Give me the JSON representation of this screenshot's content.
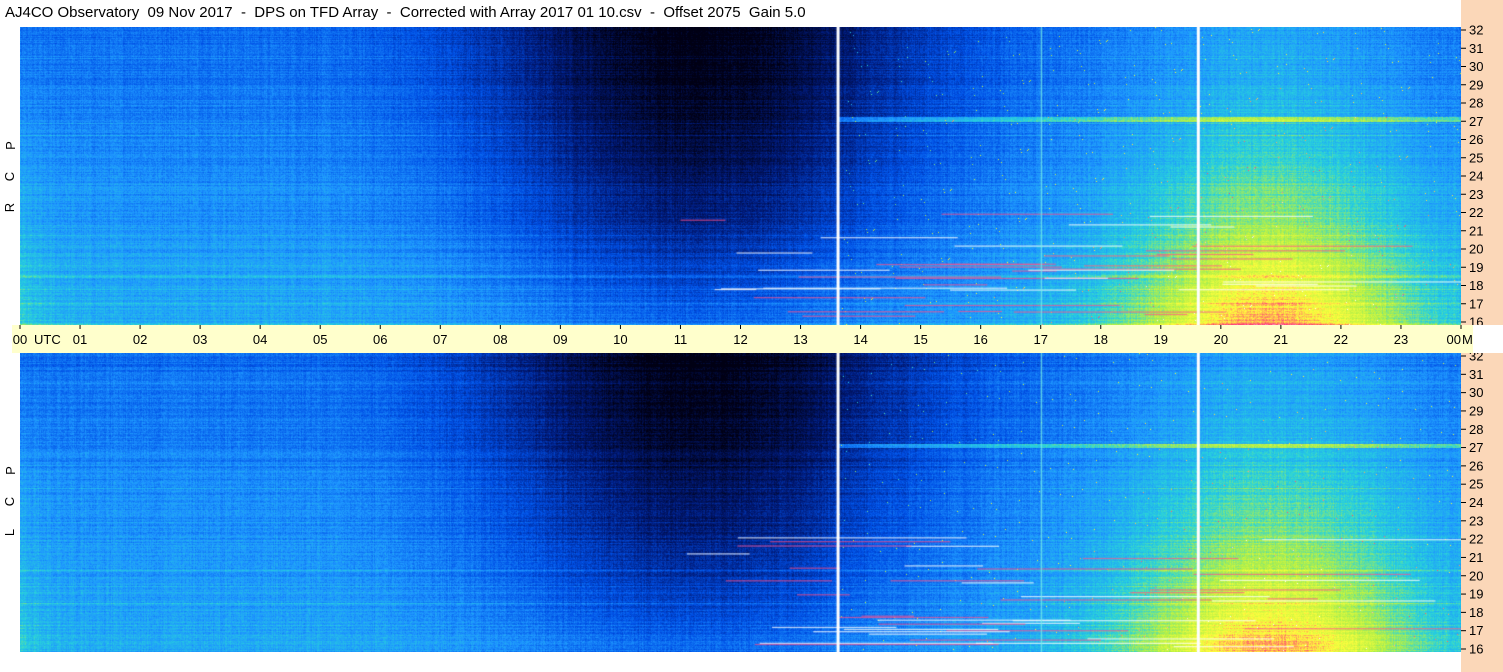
{
  "title": "AJ4CO Observatory  09 Nov 2017  -  DPS on TFD Array  -  Corrected with Array 2017 01 10.csv  -  Offset 2075  Gain 5.0",
  "panels": {
    "top_label": [
      "R",
      "C",
      "P"
    ],
    "bottom_label": [
      "L",
      "C",
      "P"
    ]
  },
  "chart_data": {
    "type": "heatmap",
    "title": "AJ4CO Observatory  09 Nov 2017  -  DPS on TFD Array  -  Corrected with Array 2017 01 10.csv  -  Offset 2075  Gain 5.0",
    "x_tick_labels": [
      "00",
      "01",
      "02",
      "03",
      "04",
      "05",
      "06",
      "07",
      "08",
      "09",
      "10",
      "11",
      "12",
      "13",
      "14",
      "15",
      "16",
      "17",
      "18",
      "19",
      "20",
      "21",
      "22",
      "23",
      "00"
    ],
    "x_unit_label": "UTC",
    "y_unit_label": "MHz",
    "xlim": [
      0,
      24
    ],
    "ylim": [
      16,
      32
    ],
    "y_tick_labels": [
      "16",
      "17",
      "18",
      "19",
      "20",
      "21",
      "22",
      "23",
      "24",
      "25",
      "26",
      "27",
      "28",
      "29",
      "30",
      "31",
      "32"
    ],
    "colormap": [
      "#000014",
      "#001a78",
      "#0050e6",
      "#1e96ff",
      "#28d2dc",
      "#b4f046",
      "#ffff3c",
      "#ff3c78",
      "#ffffff"
    ],
    "gaps_utc": [
      13.6,
      19.6
    ],
    "interference_lines_mhz": [
      27.0,
      17.5
    ],
    "interference_line_utc": 17.0
  }
}
